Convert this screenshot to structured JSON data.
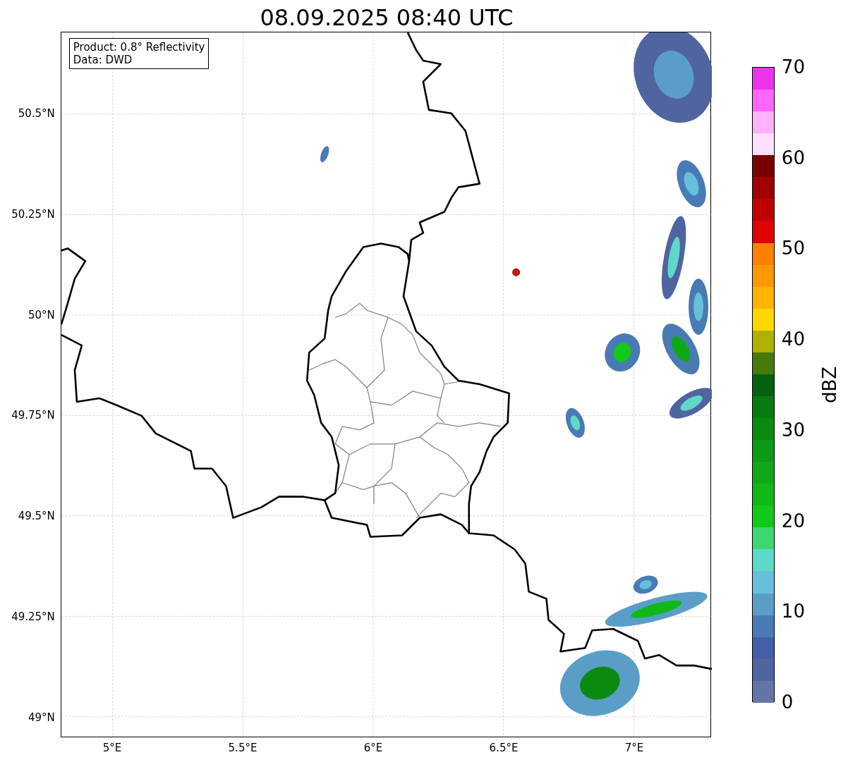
{
  "title": "08.09.2025 08:40 UTC",
  "info_box": {
    "lines": [
      "Product: 0.8° Reflectivity",
      "Data: DWD"
    ]
  },
  "map": {
    "x_ticks": [
      "5°E",
      "5.5°E",
      "6°E",
      "6.5°E",
      "7°E"
    ],
    "y_ticks": [
      "50.5°N",
      "50.25°N",
      "50°N",
      "49.75°N",
      "49.5°N",
      "49.25°N",
      "49°N"
    ]
  },
  "colorbar": {
    "label": "dBZ",
    "ticks": [
      "70",
      "60",
      "50",
      "40",
      "30",
      "20",
      "10",
      "0"
    ],
    "bands": [
      {
        "color": "#ee33ee"
      },
      {
        "color": "#ff66ff"
      },
      {
        "color": "#ffb0ff"
      },
      {
        "color": "#ffe0ff"
      },
      {
        "color": "#7a0000"
      },
      {
        "color": "#a00000"
      },
      {
        "color": "#c00000"
      },
      {
        "color": "#e00000"
      },
      {
        "color": "#ff7f00"
      },
      {
        "color": "#ff9800"
      },
      {
        "color": "#ffb400"
      },
      {
        "color": "#ffd700"
      },
      {
        "color": "#b0b000"
      },
      {
        "color": "#467a0a"
      },
      {
        "color": "#066010"
      },
      {
        "color": "#087a10"
      },
      {
        "color": "#0b8a10"
      },
      {
        "color": "#0e9a14"
      },
      {
        "color": "#10a818"
      },
      {
        "color": "#10b818"
      },
      {
        "color": "#12c81a"
      },
      {
        "color": "#3ed670"
      },
      {
        "color": "#5fd8c8"
      },
      {
        "color": "#66c0dc"
      },
      {
        "color": "#5a9ec8"
      },
      {
        "color": "#4a7ab4"
      },
      {
        "color": "#4360a6"
      },
      {
        "color": "#5064a0"
      },
      {
        "color": "#6574a6"
      }
    ]
  }
}
